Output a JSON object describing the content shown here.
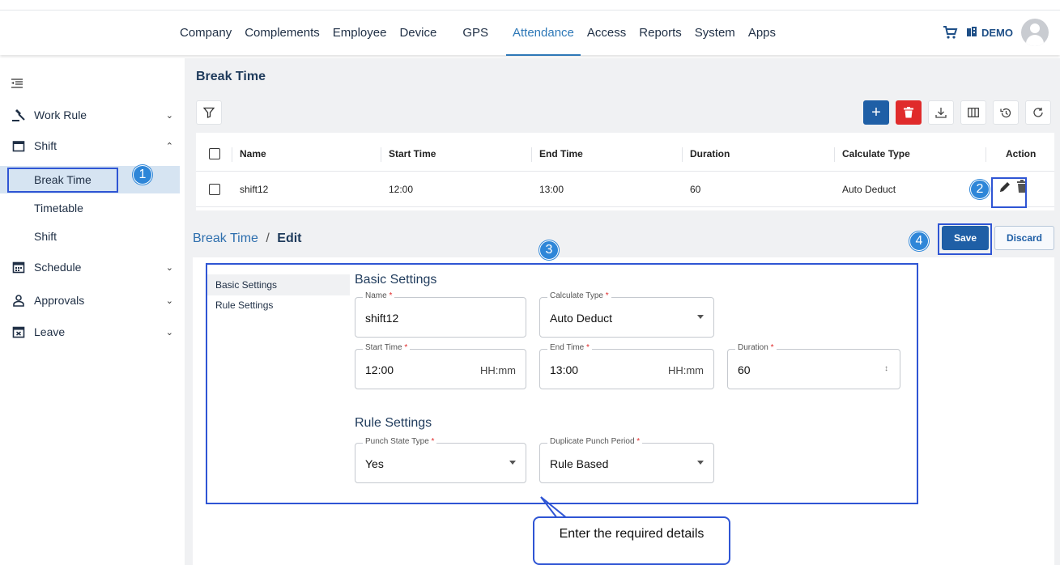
{
  "topnav": {
    "items": [
      "Company",
      "Complements",
      "Employee",
      "Device",
      "GPS",
      "Attendance",
      "Access",
      "Reports",
      "System",
      "Apps"
    ],
    "active": "Attendance",
    "org_label": "DEMO"
  },
  "sidebar": {
    "work_rule": "Work Rule",
    "shift": "Shift",
    "break_time": "Break Time",
    "timetable": "Timetable",
    "shift_sub": "Shift",
    "schedule": "Schedule",
    "approvals": "Approvals",
    "leave": "Leave"
  },
  "page": {
    "title": "Break Time"
  },
  "table": {
    "headers": [
      "Name",
      "Start Time",
      "End Time",
      "Duration",
      "Calculate Type",
      "Action"
    ],
    "rows": [
      {
        "name": "shift12",
        "start": "12:00",
        "end": "13:00",
        "duration": "60",
        "calc_type": "Auto Deduct"
      }
    ]
  },
  "edit": {
    "breadcrumb_parent": "Break Time",
    "breadcrumb_sep": "/",
    "breadcrumb_current": "Edit",
    "save_label": "Save",
    "discard_label": "Discard",
    "nav": [
      "Basic Settings",
      "Rule Settings"
    ],
    "basic_title": "Basic Settings",
    "rule_title": "Rule Settings",
    "fields": {
      "name": {
        "label": "Name",
        "value": "shift12"
      },
      "calc_type": {
        "label": "Calculate Type",
        "value": "Auto Deduct"
      },
      "start_time": {
        "label": "Start Time",
        "value": "12:00",
        "suffix": "HH:mm"
      },
      "end_time": {
        "label": "End Time",
        "value": "13:00",
        "suffix": "HH:mm"
      },
      "duration": {
        "label": "Duration",
        "value": "60"
      },
      "punch_state": {
        "label": "Punch State Type",
        "value": "Yes"
      },
      "dup_punch": {
        "label": "Duplicate Punch Period",
        "value": "Rule Based"
      }
    }
  },
  "annotations": {
    "badges": [
      "1",
      "2",
      "3",
      "4"
    ],
    "callout": "Enter the required details"
  },
  "colors": {
    "accent": "#2e78b7",
    "primary_button": "#1f5fa6",
    "danger": "#e02b2b",
    "annotation": "#2f55d4"
  }
}
